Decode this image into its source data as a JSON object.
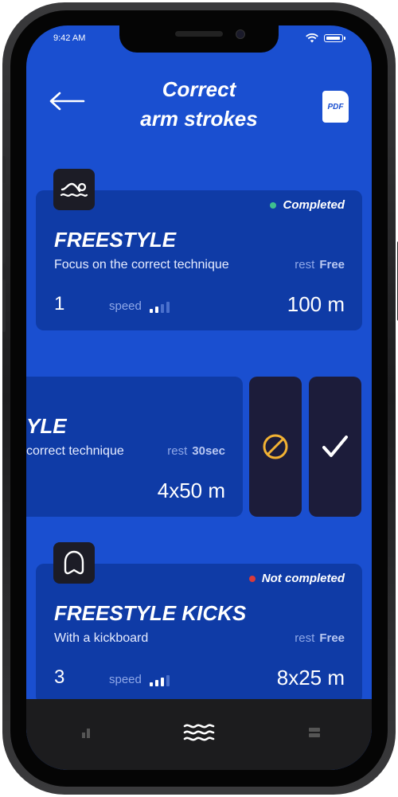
{
  "status_bar": {
    "time": "9:42 AM"
  },
  "header": {
    "title_line1": "Correct",
    "title_line2": "arm strokes",
    "pdf_label": "PDF"
  },
  "cards": [
    {
      "name": "FREESTYLE",
      "description": "Focus on the correct technique",
      "rest_label": "rest",
      "rest_value": "Free",
      "number": "1",
      "speed_label": "speed",
      "speed_level": 2,
      "speed_max": 4,
      "distance": "100 m",
      "status": "Completed",
      "status_color": "#3fbf8f",
      "icon": "swimmer-icon"
    },
    {
      "name": "YLE",
      "description": "correct technique",
      "rest_label": "rest",
      "rest_value": "30sec",
      "distance": "4x50 m",
      "actions": {
        "skip_icon": "prohibited-icon",
        "done_icon": "checkmark-icon"
      }
    },
    {
      "name": "FREESTYLE KICKS",
      "description": "With a kickboard",
      "rest_label": "rest",
      "rest_value": "Free",
      "number": "3",
      "speed_label": "speed",
      "speed_level": 3,
      "speed_max": 4,
      "distance": "8x25 m",
      "status": "Not completed",
      "status_color": "#d93a3a",
      "icon": "kickboard-icon"
    }
  ],
  "tabbar": {
    "tabs": [
      "stats-icon",
      "waves-icon",
      "list-icon"
    ],
    "active": "waves-icon"
  },
  "colors": {
    "background": "#1a4fd0",
    "card": "#0f3ba6",
    "action_bg": "#1c1c3a",
    "skip": "#f2b233"
  }
}
